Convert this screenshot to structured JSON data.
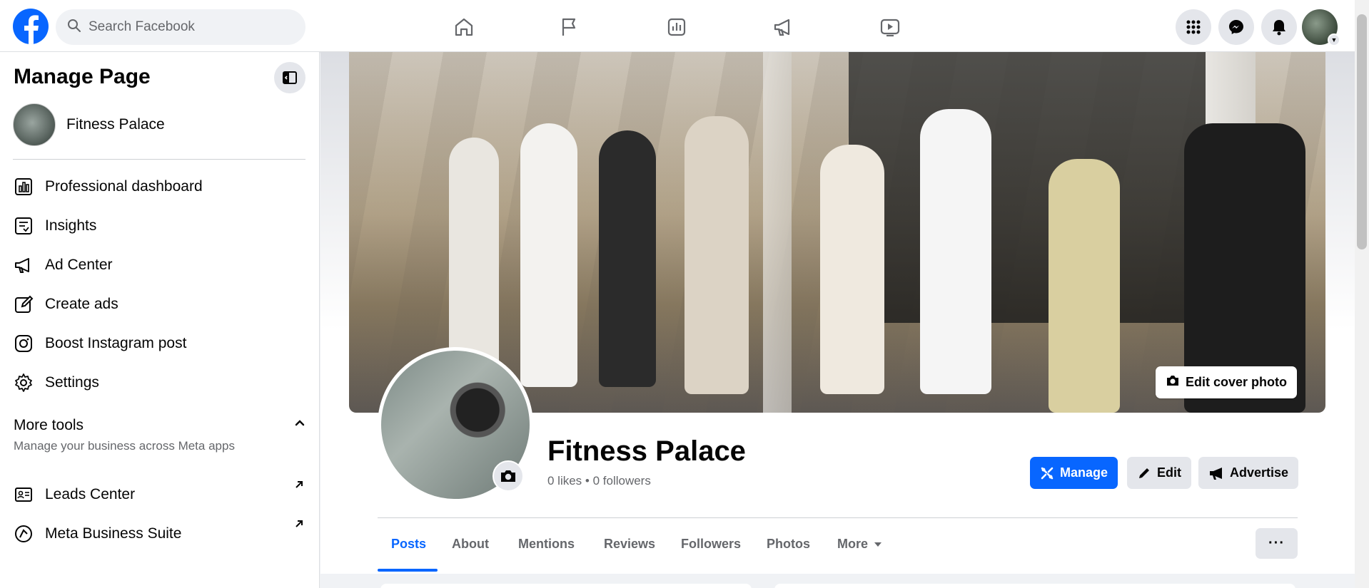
{
  "topnav": {
    "search_placeholder": "Search Facebook"
  },
  "sidebar": {
    "title": "Manage Page",
    "page_name": "Fitness Palace",
    "items": [
      {
        "label": "Professional dashboard",
        "icon": "dashboard-icon"
      },
      {
        "label": "Insights",
        "icon": "insights-icon"
      },
      {
        "label": "Ad Center",
        "icon": "megaphone-icon"
      },
      {
        "label": "Create ads",
        "icon": "pencil-icon"
      },
      {
        "label": "Boost Instagram post",
        "icon": "instagram-icon"
      },
      {
        "label": "Settings",
        "icon": "gear-icon"
      }
    ],
    "more_tools": {
      "title": "More tools",
      "subtitle": "Manage your business across Meta apps",
      "items": [
        {
          "label": "Leads Center",
          "icon": "leads-icon"
        },
        {
          "label": "Meta Business Suite",
          "icon": "meta-business-icon"
        }
      ]
    }
  },
  "profile": {
    "edit_cover_label": "Edit cover photo",
    "name": "Fitness Palace",
    "stats": "0 likes • 0 followers",
    "buttons": {
      "manage": "Manage",
      "edit": "Edit",
      "advertise": "Advertise"
    }
  },
  "tabs": [
    "Posts",
    "About",
    "Mentions",
    "Reviews",
    "Followers",
    "Photos",
    "More"
  ],
  "more_dots": "···",
  "colors": {
    "brand": "#0866ff",
    "text": "#050505",
    "secondary_text": "#65676b",
    "button_bg": "#e4e6eb",
    "page_bg": "#f0f2f5"
  }
}
